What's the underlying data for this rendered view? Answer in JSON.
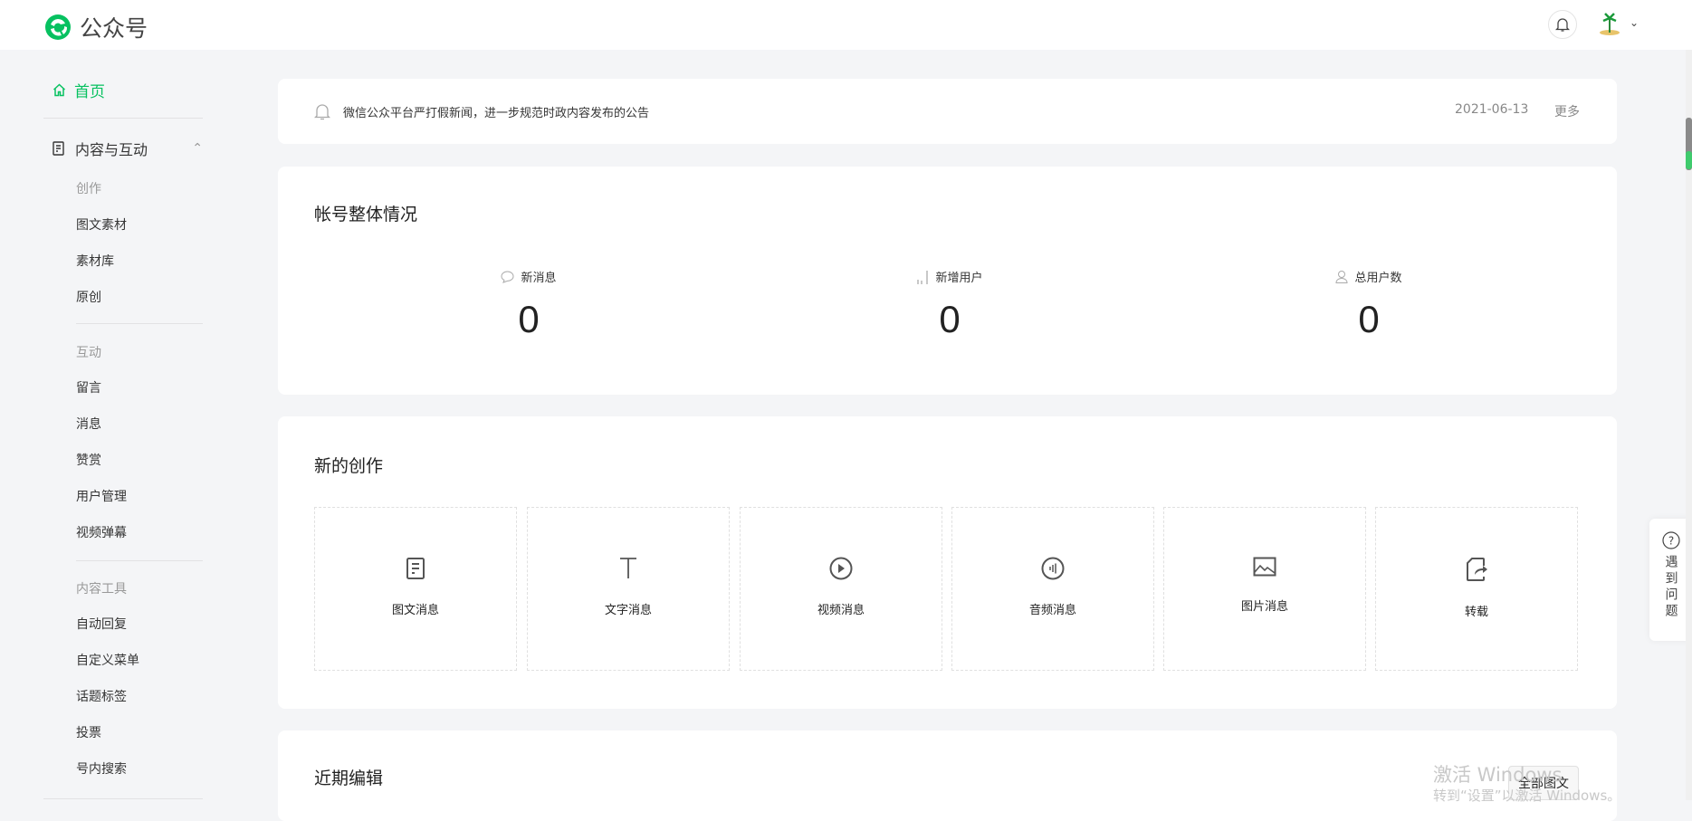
{
  "header": {
    "app_name": "公众号",
    "brand_color": "#07c160"
  },
  "sidebar": {
    "home": "首页",
    "group": "内容与互动",
    "sections": [
      {
        "category": "创作",
        "items": [
          "图文素材",
          "素材库",
          "原创"
        ]
      },
      {
        "category": "互动",
        "items": [
          "留言",
          "消息",
          "赞赏",
          "用户管理",
          "视频弹幕"
        ]
      },
      {
        "category": "内容工具",
        "items": [
          "自动回复",
          "自定义菜单",
          "话题标签",
          "投票",
          "号内搜索"
        ]
      }
    ]
  },
  "notice": {
    "text": "微信公众平台严打假新闻，进一步规范时政内容发布的公告",
    "date": "2021-06-13",
    "more": "更多"
  },
  "overview": {
    "title": "帐号整体情况",
    "stats": [
      {
        "label": "新消息",
        "value": "0"
      },
      {
        "label": "新增用户",
        "value": "0"
      },
      {
        "label": "总用户数",
        "value": "0"
      }
    ]
  },
  "create": {
    "title": "新的创作",
    "tiles": [
      "图文消息",
      "文字消息",
      "视频消息",
      "音频消息",
      "图片消息",
      "转载"
    ]
  },
  "recent": {
    "title": "近期编辑",
    "all_button": "全部图文"
  },
  "help": {
    "label": "遇到问题"
  },
  "watermark": {
    "line1": "激活 Windows",
    "line2": "转到“设置”以激活 Windows。"
  }
}
